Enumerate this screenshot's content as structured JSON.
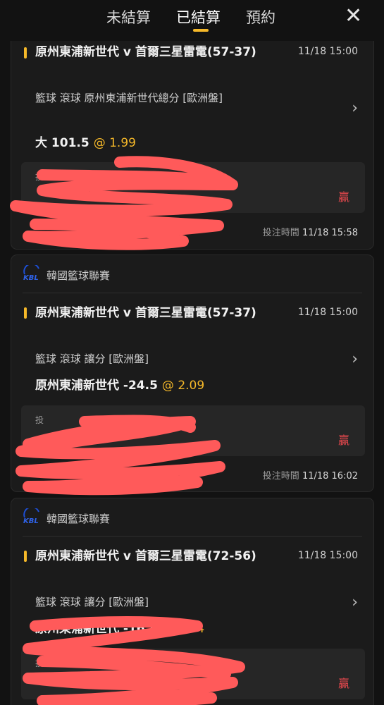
{
  "tabs": [
    "未結算",
    "已結算",
    "預約"
  ],
  "close_icon": "✕",
  "accent": "#f5b829",
  "win_color": "#e5484d",
  "redaction_color": "#ff5a5a",
  "cards": [
    {
      "league": "",
      "match": "原州東浦新世代 v 首爾三星雷電(57-37)",
      "time": "11/18 15:00",
      "market": "籃球 滾球  原州東浦新世代總分 [歐洲盤]",
      "selection": "大 101.5",
      "odds": "@ 1.99",
      "result_label": "投",
      "result": "贏",
      "bet_time_label": "投注時間",
      "bet_time": "11/18 15:58"
    },
    {
      "league": "韓國籃球聯賽",
      "logo_text": "KBL",
      "match": "原州東浦新世代 v 首爾三星雷電(57-37)",
      "time": "11/18 15:00",
      "market": "籃球 滾球  讓分 [歐洲盤]",
      "selection": "原州東浦新世代 -24.5",
      "odds": "@ 2.09",
      "result_label": "投",
      "result": "贏",
      "bet_time_label": "投注時間",
      "bet_time": "11/18 16:02"
    },
    {
      "league": "韓國籃球聯賽",
      "logo_text": "KBL",
      "match": "原州東浦新世代 v 首爾三星雷電(72-56)",
      "time": "11/18 15:00",
      "market": "籃球 滾球  讓分 [歐洲盤]",
      "selection": "原州東浦新世代 -16.5",
      "odds": "@ 1.84",
      "result_label": "投",
      "result": "贏"
    }
  ]
}
